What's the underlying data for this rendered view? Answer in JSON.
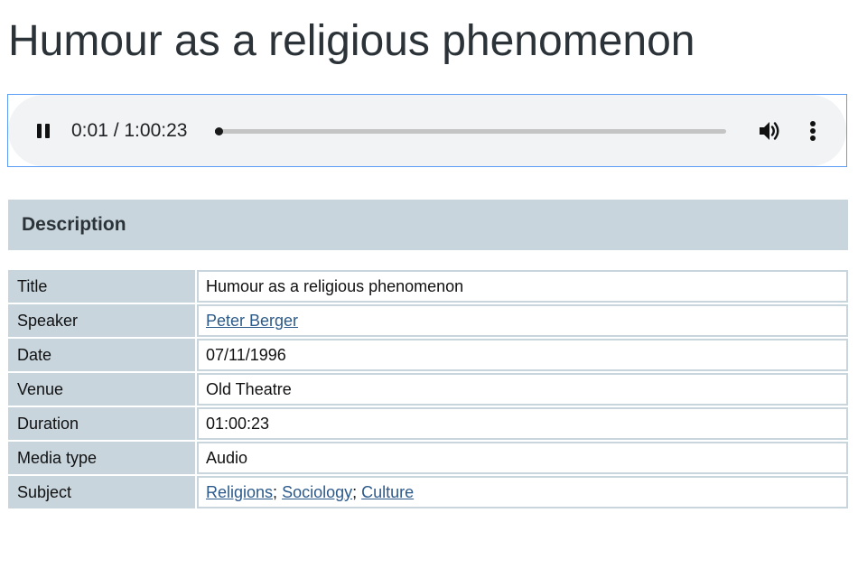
{
  "page": {
    "title": "Humour as a religious phenomenon"
  },
  "player": {
    "time_display": "0:01 / 1:00:23",
    "progress_fraction": 0.0003,
    "state": "playing",
    "icons": {
      "pause": "pause-icon",
      "volume": "volume-icon",
      "more": "more-vert-icon"
    }
  },
  "description": {
    "heading": "Description",
    "rows": {
      "title": {
        "label": "Title",
        "value": "Humour as a religious phenomenon"
      },
      "speaker": {
        "label": "Speaker",
        "value": "Peter Berger"
      },
      "date": {
        "label": "Date",
        "value": "07/11/1996"
      },
      "venue": {
        "label": "Venue",
        "value": "Old Theatre"
      },
      "duration": {
        "label": "Duration",
        "value": "01:00:23"
      },
      "media_type": {
        "label": "Media type",
        "value": "Audio"
      },
      "subject": {
        "label": "Subject",
        "values": [
          "Religions",
          "Sociology",
          "Culture"
        ],
        "separator": "; "
      }
    }
  },
  "colors": {
    "panel": "#c8d5dd",
    "link": "#2c5a8a",
    "focus_border": "#5b9df5",
    "player_bg": "#f1f3f4"
  }
}
